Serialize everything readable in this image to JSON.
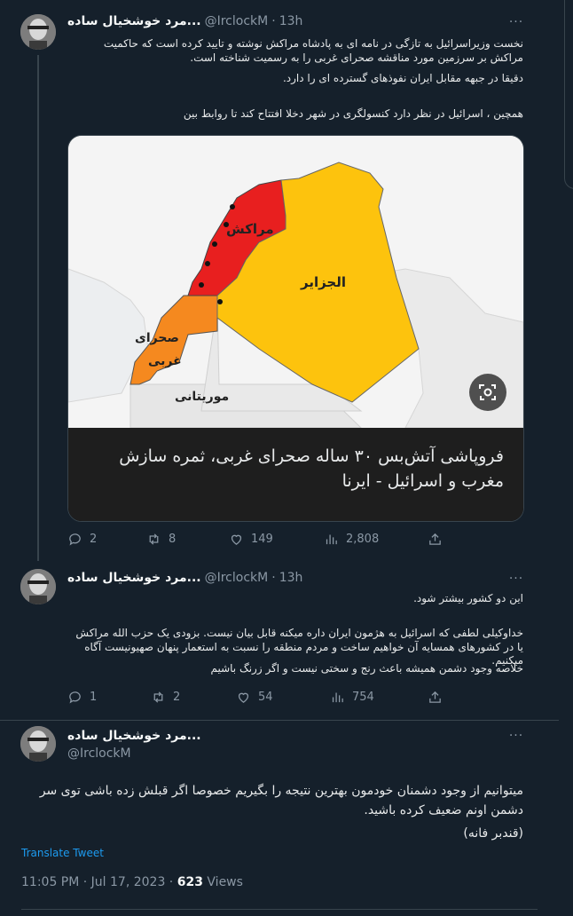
{
  "tweets": [
    {
      "author_name": "مرد خوشخیال ساده...",
      "handle": "@IrclockM",
      "time": "13h",
      "paragraphs": [
        "نخست وزیراسرائیل به تازگی در نامه ای  به پادشاه مراکش نوشته و تایید کرده است که حاکمیت مراکش بر سرزمین مورد مناقشه صحرای غربی را به رسمیت شناخته است.",
        "دقیقا در جبهه مقابل ایران نفوذهای گسترده ای را دارد.",
        "همچین ، اسرائیل در نظر دارد کنسولگری در شهر دخلا افتتاح کند تا روابط بین"
      ],
      "card": {
        "map_labels": {
          "morocco": "مراکش",
          "algeria": "الجزایر",
          "western_sahara_1": "صحرای",
          "western_sahara_2": "غربی",
          "mauritania": "موریتانی"
        },
        "caption": "فروپاشی آتش‌بس ۳۰ ساله صحرای غربی، ثمره سازش مغرب و اسرائیل - ایرنا"
      },
      "stats": {
        "replies": "2",
        "retweets": "8",
        "likes": "149",
        "views": "2,808"
      }
    },
    {
      "author_name": "مرد خوشخیال ساده...",
      "handle": "@IrclockM",
      "time": "13h",
      "paragraphs": [
        "این دو کشور بیشتر شود.",
        "خداوکیلی لطفی که اسرائیل به هژمون ایران داره میکنه قابل بیان نیست. بزودی یک حزب الله مراکش یا در کشورهای همسایه آن خواهیم ساخت و مردم منطقه را نسبت به استعمار پنهان صهیونیست آگاه میکنیم.",
        "خلاصه وجود دشمن همیشه باعث رنج و سختی نیست و اگر زرنگ باشیم"
      ],
      "stats": {
        "replies": "1",
        "retweets": "2",
        "likes": "54",
        "views": "754"
      }
    },
    {
      "author_name": "مرد خوشخیال ساده...",
      "handle": "@IrclockM",
      "paragraphs": [
        "میتوانیم از وجود دشمنان خودمون بهترین نتیجه را بگیریم خصوصا اگر قبلش زده باشی توی سر دشمن اونم ضعیف کرده باشید.",
        "(قندبر فانه)"
      ],
      "translate_label": "Translate Tweet",
      "timestamp": "11:05 PM · Jul 17, 2023 · ",
      "views_count": "623",
      "views_label": " Views"
    }
  ],
  "more_label": "···"
}
